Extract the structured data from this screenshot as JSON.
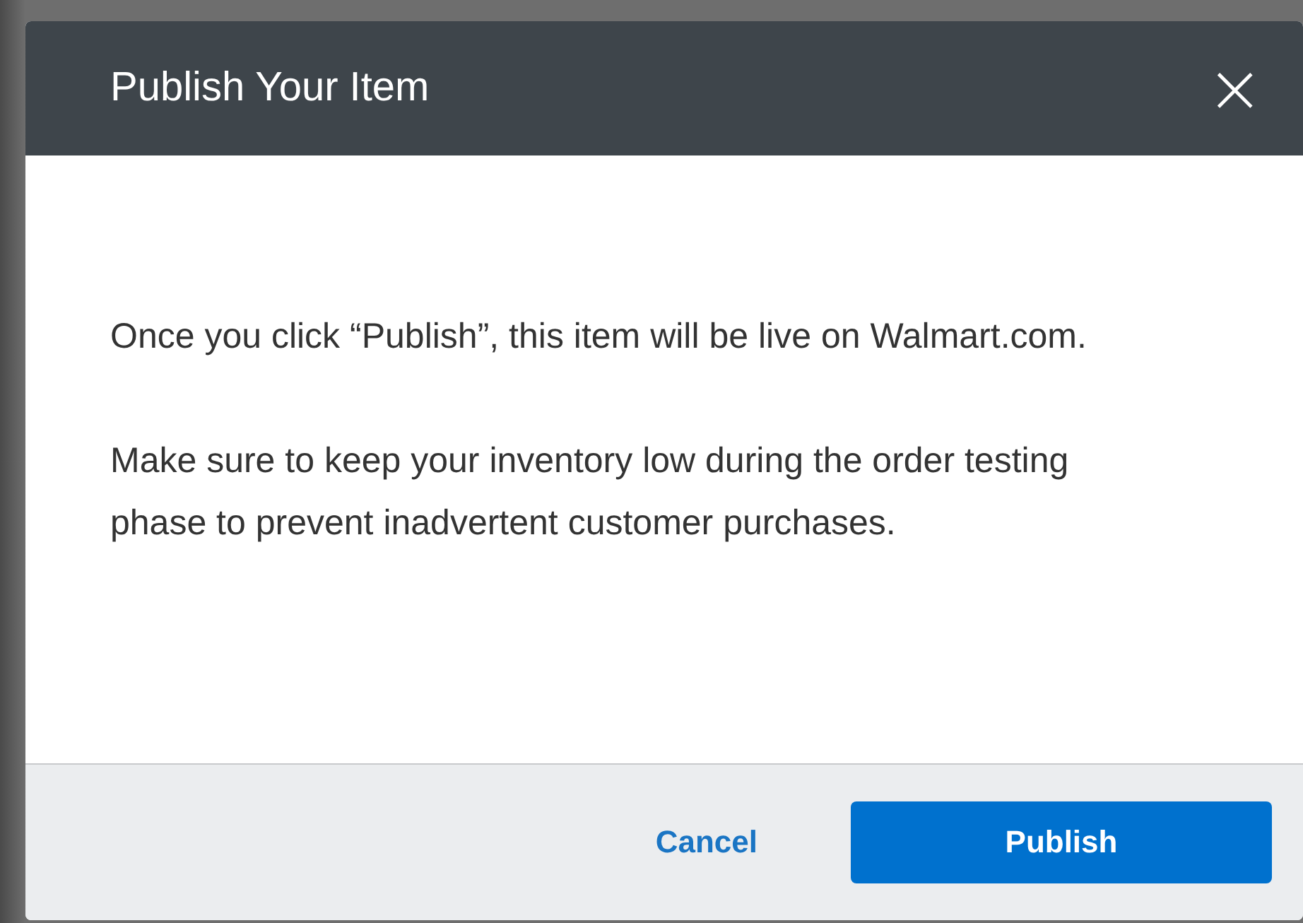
{
  "dialog": {
    "title": "Publish Your Item",
    "close": "×",
    "paragraphs": [
      "Once you click “Publish”, this item will be live on Walmart.com.",
      "Make sure to keep your inventory low during the order testing phase to prevent inadvertent customer purchases."
    ],
    "buttons": [
      {
        "label": "Cancel",
        "kind": "link"
      },
      {
        "label": "Publish",
        "kind": "primary"
      }
    ]
  }
}
